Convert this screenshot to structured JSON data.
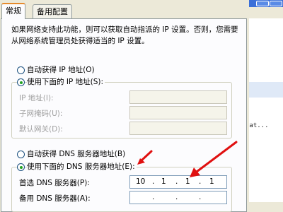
{
  "tabs": [
    "常规",
    "备用配置"
  ],
  "intro": "如果网络支持此功能，则可以获取自动指派的 IP 设置。否则，您需要从网络系统管理员处获得适当的 IP 设置。",
  "ip_section": {
    "auto_label": "自动获得 IP 地址(O)",
    "manual_label": "使用下面的 IP 地址(S):",
    "ip_address_label": "IP 地址(I):",
    "subnet_label": "子网掩码(U):",
    "gateway_label": "默认网关(D):"
  },
  "dns_section": {
    "auto_label": "自动获得 DNS 服务器地址(B)",
    "manual_label": "使用下面的 DNS 服务器地址(E):",
    "preferred_label": "首选 DNS 服务器(P):",
    "preferred_value": [
      "10",
      "1",
      "1",
      "1"
    ],
    "alternate_label": "备用 DNS 服务器(A):",
    "alternate_value": [
      "",
      "",
      "",
      ""
    ]
  },
  "background": {
    "text": "rat..."
  },
  "colors": {
    "annotation_arrow": "#e01010",
    "dialog_bg": "#ece9d8",
    "tab_accent": "#e68b2c"
  }
}
